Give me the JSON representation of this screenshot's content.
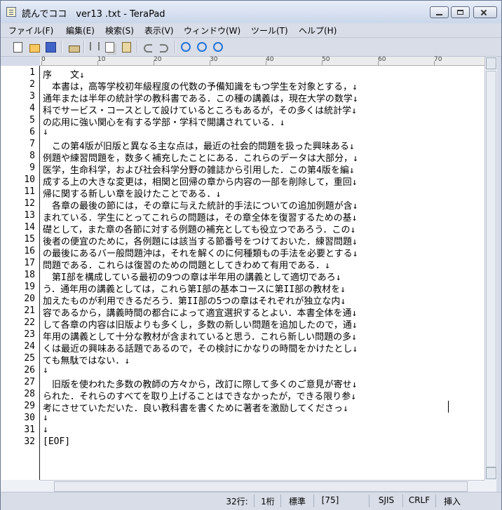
{
  "window": {
    "title": "読んでココ　ver13 .txt - TeraPad"
  },
  "menu": [
    "ファイル(F)",
    "編集(E)",
    "検索(S)",
    "表示(V)",
    "ウィンドウ(W)",
    "ツール(T)",
    "ヘルプ(H)"
  ],
  "toolbar": {
    "buttons": [
      "new-file-icon",
      "open-folder-icon",
      "save-icon",
      "print-icon",
      "cut-icon",
      "copy-icon",
      "paste-icon",
      "undo-icon",
      "redo-icon",
      "search-icon",
      "find-next-icon",
      "find-prev-icon"
    ]
  },
  "ruler": {
    "labels": [
      "0",
      "10",
      "20",
      "30",
      "40",
      "50",
      "60",
      "70"
    ]
  },
  "editor": {
    "lines": [
      "序　　文↓",
      "　本書は，高等学校初年級程度の代数の予備知識をもつ学生を対象とする，↓",
      "通年または半年の統計学の教科書である．この種の講義は，現在大学の数学↓",
      "科でサービス・コースとして設けているところもあるが，その多くは統計学↓",
      "の応用に強い関心を有する学部・学科で開講されている．↓",
      "↓",
      "　この第4版が旧版と異なる主な点は，最近の社会的問題を扱った興味ある↓",
      "例題や練習問題を，数多く補充したことにある．これらのデータは大部分，↓",
      "医学，生命科学，および社会科学分野の雑誌から引用した．この第4版を編↓",
      "成する上の大きな変更は，相関と回帰の章から内容の一部を削除して，重回↓",
      "帰に関する新しい章を設けたことである．↓",
      "　各章の最後の節には，その章に与えた統計的手法についての追加例題が含↓",
      "まれている．学生にとってこれらの問題は，その章全体を復習するための基↓",
      "礎として，また章の各節に対する例題の補充としても役立つであろう．この↓",
      "後者の便宜のために，各例題には該当する節番号をつけておいた．練習問題↓",
      "の最後にあるバー般問題沖は，それを解くのに何種類もの手法を必要とする↓",
      "問題である．これらは復習のための問題としてきわめて有用である．↓",
      "　第I部を構成している最初の9つの章は半年用の講義として適切であろ↓",
      "う．通年用の講義としては，これら第I部の基本コースに第II部の教材を↓",
      "加えたものが利用できるだろう．第II部の5つの章はそれぞれが独立な内↓",
      "容であるから，講義時間の都合によって適宜選択するとよい．本書全体を通↓",
      "して各章の内容は旧版よりも多くし，多数の新しい問題を追加したので，通↓",
      "年用の講義として十分な教材が含まれていると思う．これら新しい問題の多↓",
      "くは最近の興味ある話題であるので，その検討にかなりの時間をかけたとし↓",
      "ても無駄ではない．↓",
      "↓",
      "　旧版を使われた多数の教師の方々から，改訂に際して多くのご意見が寄せ↓",
      "られた．それらのすべてを取り上げることはできなかったが，できる限り参↓",
      "考にさせていただいた．良い教科書を書くために著者を激励してくださっ↓",
      "↓",
      "↓",
      "[EOF]"
    ]
  },
  "status": {
    "line": "32行:",
    "col": "1桁",
    "mode": "標準",
    "code": "[75]",
    "encoding": "SJIS",
    "newline": "CRLF",
    "insert": "挿入"
  }
}
